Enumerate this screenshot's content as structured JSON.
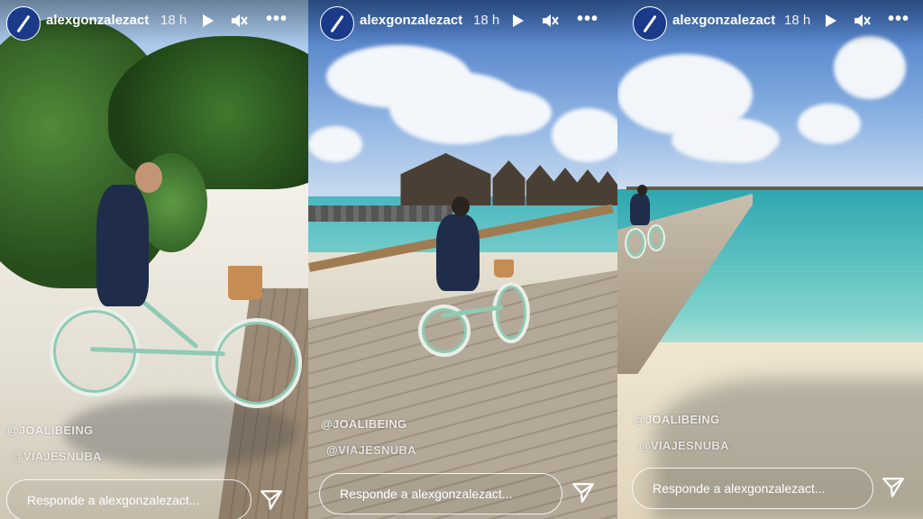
{
  "stories": [
    {
      "username": "alexgonzalezact",
      "time": "18 h",
      "mentions": [
        "@JOALIBEING",
        "@VIAJESNUBA"
      ],
      "reply_placeholder": "Responde a alexgonzalezact..."
    },
    {
      "username": "alexgonzalezact",
      "time": "18 h",
      "mentions": [
        "@JOALIBEING",
        "@VIAJESNUBA"
      ],
      "reply_placeholder": "Responde a alexgonzalezact..."
    },
    {
      "username": "alexgonzalezact",
      "time": "18 h",
      "mentions": [
        "@JOALIBEING",
        "@VIAJESNUBA"
      ],
      "reply_placeholder": "Responde a alexgonzalezact..."
    }
  ],
  "icons": {
    "play": "play-icon",
    "mute": "muted-speaker-icon",
    "more": "more-options-icon",
    "send": "send-paper-plane-icon",
    "avatar": "profile-avatar"
  },
  "colors": {
    "avatar_bg": "#1b3a8a",
    "text": "#ffffff"
  }
}
